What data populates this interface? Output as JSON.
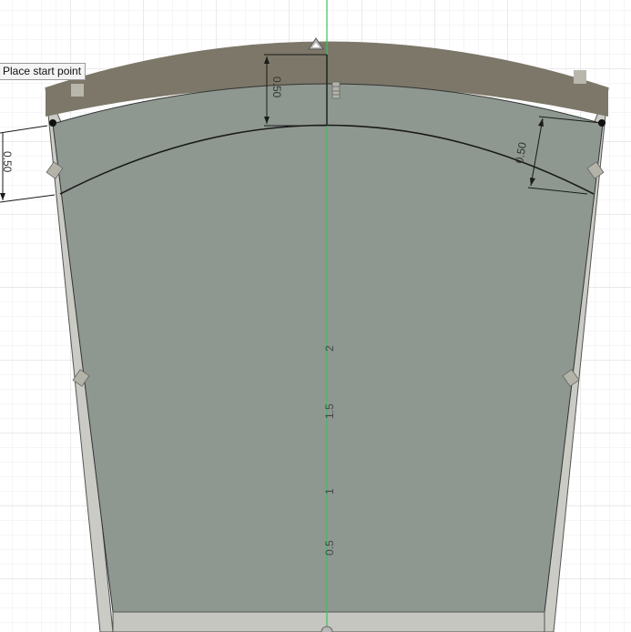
{
  "tooltip": {
    "text": "Place start point"
  },
  "dimensions": {
    "top_center": "0.50",
    "left": "0.50",
    "right": "0.50"
  },
  "axis": {
    "labels": [
      "0.5",
      "1",
      "1.5",
      "2"
    ]
  },
  "colors": {
    "face_fill": "#8e9891",
    "wall_fill": "#c5c8c1",
    "rim_fill": "#7c7768",
    "axis_line": "#3cc05a",
    "grid_line": "#dedede",
    "sketch_line": "#1a1a1a"
  }
}
